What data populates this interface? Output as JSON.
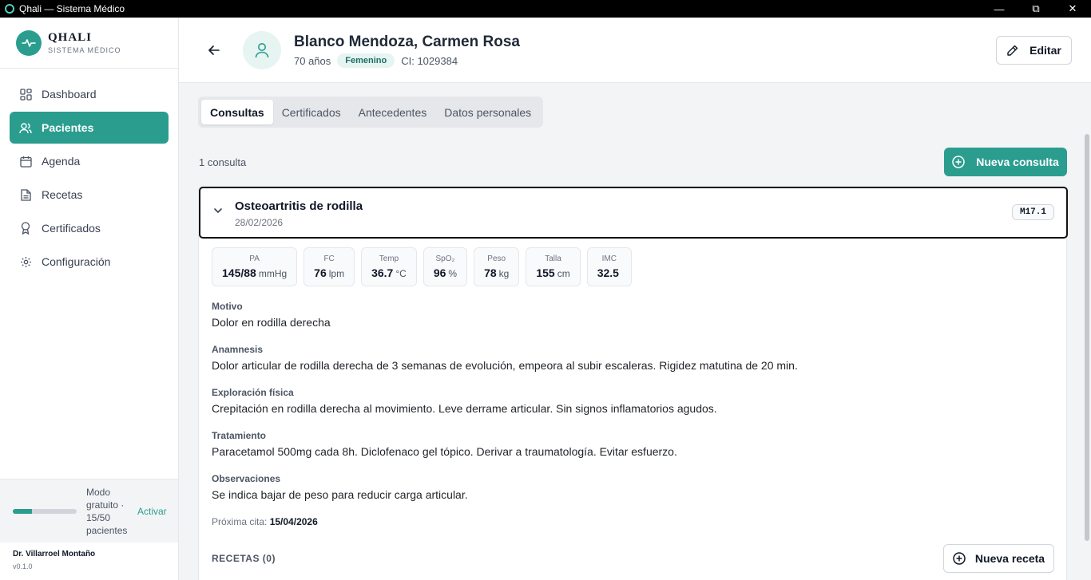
{
  "window": {
    "title": "Qhali — Sistema Médico"
  },
  "brand": {
    "name": "QHALI",
    "subtitle": "SISTEMA MÉDICO"
  },
  "nav": [
    {
      "label": "Dashboard",
      "icon": "dashboard-icon"
    },
    {
      "label": "Pacientes",
      "icon": "users-icon",
      "active": true
    },
    {
      "label": "Agenda",
      "icon": "calendar-icon"
    },
    {
      "label": "Recetas",
      "icon": "document-icon"
    },
    {
      "label": "Certificados",
      "icon": "award-icon"
    },
    {
      "label": "Configuración",
      "icon": "gear-icon"
    }
  ],
  "plan": {
    "text": "Modo gratuito · 15/50 pacientes",
    "activate": "Activar",
    "progress": 0.3
  },
  "user": {
    "name": "Dr. Villarroel Montaño",
    "version": "v0.1.0"
  },
  "patient": {
    "name": "Blanco Mendoza, Carmen Rosa",
    "age": "70 años",
    "sex": "Femenino",
    "ci": "CI: 1029384"
  },
  "header": {
    "edit_label": "Editar"
  },
  "tabs": [
    {
      "label": "Consultas",
      "active": true
    },
    {
      "label": "Certificados"
    },
    {
      "label": "Antecedentes"
    },
    {
      "label": "Datos personales"
    }
  ],
  "consults": {
    "count": "1 consulta",
    "new_label": "Nueva consulta"
  },
  "consult": {
    "title": "Osteoartritis de rodilla",
    "date": "28/02/2026",
    "code": "M17.1",
    "vitals": [
      {
        "label": "PA",
        "value": "145/88",
        "unit": "mmHg"
      },
      {
        "label": "FC",
        "value": "76",
        "unit": "lpm"
      },
      {
        "label": "Temp",
        "value": "36.7",
        "unit": "°C"
      },
      {
        "label": "SpO₂",
        "value": "96",
        "unit": "%"
      },
      {
        "label": "Peso",
        "value": "78",
        "unit": "kg"
      },
      {
        "label": "Talla",
        "value": "155",
        "unit": "cm"
      },
      {
        "label": "IMC",
        "value": "32.5",
        "unit": ""
      }
    ],
    "sections": [
      {
        "label": "Motivo",
        "text": "Dolor en rodilla derecha"
      },
      {
        "label": "Anamnesis",
        "text": "Dolor articular de rodilla derecha de 3 semanas de evolución, empeora al subir escaleras. Rigidez matutina de 20 min."
      },
      {
        "label": "Exploración física",
        "text": "Crepitación en rodilla derecha al movimiento. Leve derrame articular. Sin signos inflamatorios agudos."
      },
      {
        "label": "Tratamiento",
        "text": "Paracetamol 500mg cada 8h. Diclofenaco gel tópico. Derivar a traumatología. Evitar esfuerzo."
      },
      {
        "label": "Observaciones",
        "text": "Se indica bajar de peso para reducir carga articular."
      }
    ],
    "next_label": "Próxima cita:",
    "next_date": "15/04/2026",
    "recetas_label": "RECETAS (0)",
    "new_recipe_label": "Nueva receta"
  },
  "colors": {
    "accent": "#2a9d8f",
    "accent_light": "#e6f4f2"
  }
}
